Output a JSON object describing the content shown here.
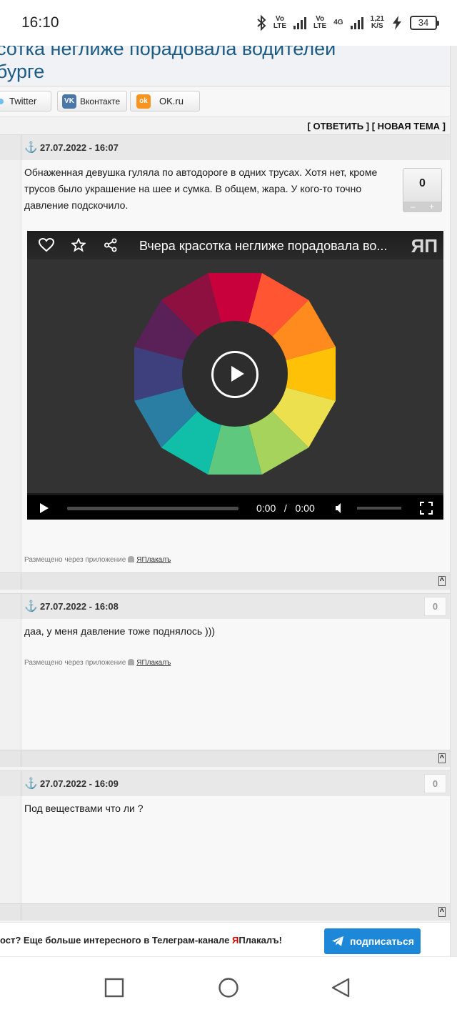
{
  "status_bar": {
    "time": "16:10",
    "vo1_top": "Vo",
    "vo1_bottom": "LTE",
    "vo2_top": "Vo",
    "vo2_bottom": "LTE",
    "net_top": "4G",
    "speed_top": "1,21",
    "speed_bottom": "K/S",
    "battery": "34"
  },
  "topic": {
    "title": "асотка неглиже порадовала водителей\nнбурге"
  },
  "share": {
    "twitter": "Twitter",
    "vk": "Вконтакте",
    "vk_icon_text": "VK",
    "ok": "OK.ru",
    "ok_icon_text": "ok"
  },
  "actions": {
    "reply_new": "[ ОТВЕТИТЬ ] [ НОВАЯ ТЕМА ]"
  },
  "posts": [
    {
      "date": "27.07.2022 - 16:07",
      "text": "Обнаженная девушка гуляла по автодороге в одних трусах. Хотя нет, кроме трусов было украшение на шее и сумка. В общем, жара. У кого-то точно давление подскочило.",
      "rating": "0",
      "rating_minus": "–",
      "rating_plus": "+",
      "via_prefix": "Размещено через приложение",
      "via_app": "ЯПлакалъ",
      "top_link": "^"
    },
    {
      "date": "27.07.2022 - 16:08",
      "text": "даа, у меня давление тоже поднялось )))",
      "rating": "0",
      "via_prefix": "Размещено через приложение",
      "via_app": "ЯПлакалъ",
      "top_link": "^"
    },
    {
      "date": "27.07.2022 - 16:09",
      "text": "Под веществами что ли ?",
      "rating": "0",
      "top_link": "^"
    }
  ],
  "video": {
    "title": "Вчера красотка неглиже порадовала во...",
    "logo": "ЯП",
    "current_time": "0:00",
    "separator": "/",
    "duration": "0:00",
    "progress": 0,
    "wheel_colors": [
      "#c8003c",
      "#ff5533",
      "#ff8a1e",
      "#ffc107",
      "#ede04f",
      "#a6d35b",
      "#5ec97e",
      "#11bfa8",
      "#2a7ea3",
      "#3e3f7d",
      "#5a2158",
      "#8e1040"
    ],
    "wheel_center": "#2d2d2d"
  },
  "telegram": {
    "text_before": "ост? Еще больше интересного в Телеграм-канале ",
    "brand_red": "Я",
    "brand_rest": "Плакалъ!",
    "button": "подписаться",
    "button_color": "#1e88d8"
  }
}
